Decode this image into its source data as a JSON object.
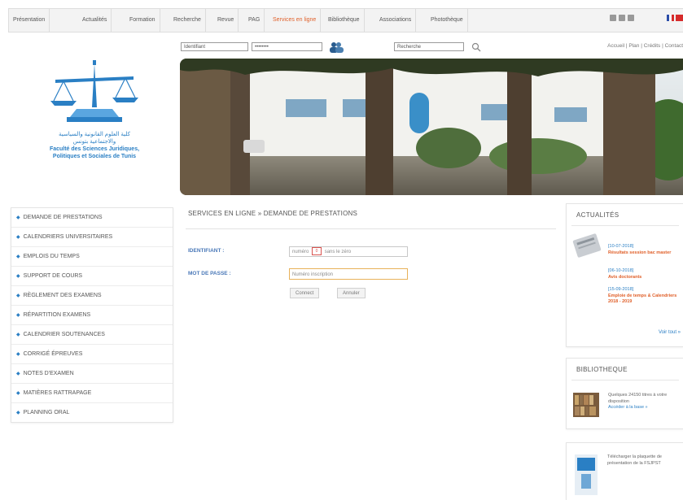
{
  "topnav": {
    "items": [
      "Présentation",
      "Actualités",
      "Formation",
      "Recherche",
      "Revue",
      "PAG",
      "Services en ligne",
      "Bibliothèque",
      "Associations",
      "Photothèque"
    ],
    "active_index": 6
  },
  "search": {
    "identifiant_placeholder": "Identifiant",
    "password_placeholder": "••••••••",
    "query_placeholder": "Recherche",
    "toplinks": "Accueil  |  Plan  |  Crédits  |  Contact"
  },
  "logo": {
    "arabic_line1": "كلية العلوم القانونية والسياسية",
    "arabic_line2": "والاجتماعية بتونس",
    "french_line1": "Faculté des Sciences Juridiques,",
    "french_line2": "Politiques et Sociales de Tunis"
  },
  "leftmenu": {
    "items": [
      "DEMANDE DE PRESTATIONS",
      "CALENDRIERS UNIVERSITAIRES",
      "EMPLOIS DU TEMPS",
      "SUPPORT DE COURS",
      "RÈGLEMENT DES EXAMENS",
      "RÉPARTITION EXAMENS",
      "CALENDRIER SOUTENANCES",
      "CORRIGÉ ÉPREUVES",
      "NOTES D'EXAMEN",
      "MATIÈRES RATTRAPAGE",
      "PLANNING ORAL"
    ]
  },
  "main": {
    "breadcrumb": "SERVICES EN LIGNE » DEMANDE DE PRESTATIONS",
    "identifiant_label": "IDENTIFIANT :",
    "identifiant_value": "numéro",
    "identifiant_suffix": "sans le zéro",
    "password_label": "MOT DE PASSE :",
    "password_placeholder": "Numéro inscription",
    "connect_label": "Connect",
    "cancel_label": "Annuler"
  },
  "actualites": {
    "title": "ACTUALITÉS",
    "items": [
      {
        "date": "[10-07-2018]",
        "text": "Résultats session bac master"
      },
      {
        "date": "[06-10-2018]",
        "text": "Avis doctorants"
      },
      {
        "date": "[15-09-2018]",
        "text": "Emploie de temps & Calendriers 2018 - 2019"
      }
    ],
    "more": "Voir tout »"
  },
  "bibliotheque": {
    "title": "BIBLIOTHEQUE",
    "text": "Quelques 24150 titres à votre disposition",
    "link": "Accéder à la base »"
  },
  "brochure": {
    "text": "Télécharger la plaquette de présentation de la FSJPST"
  },
  "colors": {
    "accent": "#2a7fc4",
    "active": "#e0602a",
    "label": "#4a78b8"
  }
}
